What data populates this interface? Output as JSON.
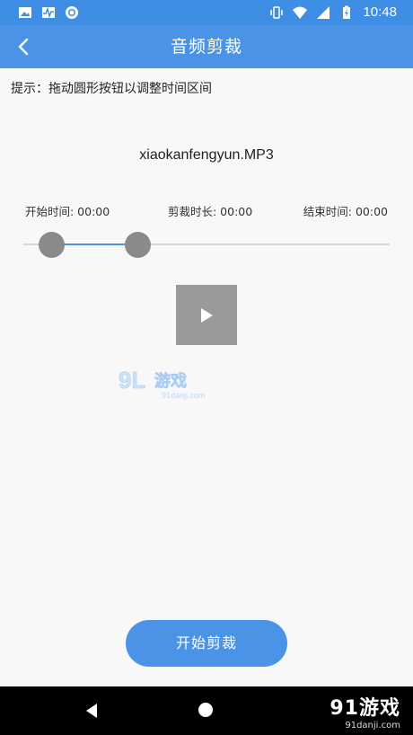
{
  "status_bar": {
    "time": "10:48",
    "left_icons": [
      "image-icon",
      "activity-icon",
      "circle-icon"
    ],
    "right_icons": [
      "vibrate-icon",
      "wifi-icon",
      "signal-icon",
      "battery-icon"
    ]
  },
  "app_bar": {
    "title": "音频剪裁",
    "back_icon": "chevron-left-icon"
  },
  "hint": "提示：拖动圆形按钮以调整时间区间",
  "file": {
    "name": "xiaokanfengyun.MP3"
  },
  "times": {
    "start": "开始时间: 00:00",
    "duration": "剪裁时长: 00:00",
    "end": "结束时间: 00:00"
  },
  "player": {
    "play_icon": "play-icon"
  },
  "watermark": {
    "text": "91游戏",
    "url": "91danji.com"
  },
  "action": {
    "cut_label": "开始剪裁"
  },
  "corner_logo": {
    "text": "91游戏",
    "url": "91danji.com"
  },
  "colors": {
    "status_bar": "#3f8ee6",
    "app_bar": "#4a93e6",
    "accent": "#4a93e6",
    "handle": "#8a8a8a",
    "play_button": "#9a9a9a"
  }
}
